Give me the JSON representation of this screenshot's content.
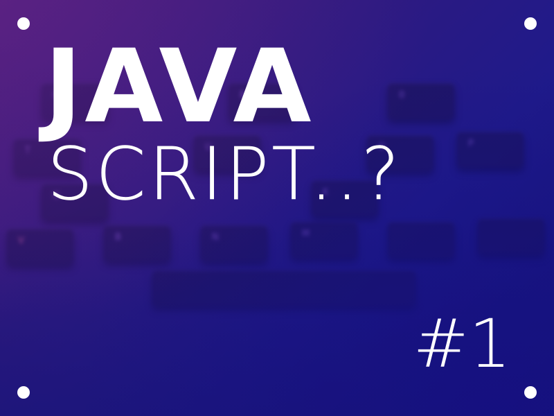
{
  "title": {
    "line1": "JAVA",
    "line2": "SCRIPT..?"
  },
  "episode": "#1",
  "colors": {
    "text": "#ffffff",
    "dots": "#ffffff",
    "background_top_left": "#4a1c7a",
    "background_bottom_right": "#14137a",
    "key_legend_purple": "#a46be8",
    "key_legend_pink": "#ff6fa8"
  },
  "background": {
    "description_icon": "keyboard-photo",
    "key_legends": [
      "G",
      "B",
      "0",
      "T",
      "U",
      "O",
      "P",
      "G",
      "K",
      "V",
      "B",
      "N",
      "M"
    ]
  },
  "decor": {
    "corner_dot_icon": "circle-dot"
  }
}
